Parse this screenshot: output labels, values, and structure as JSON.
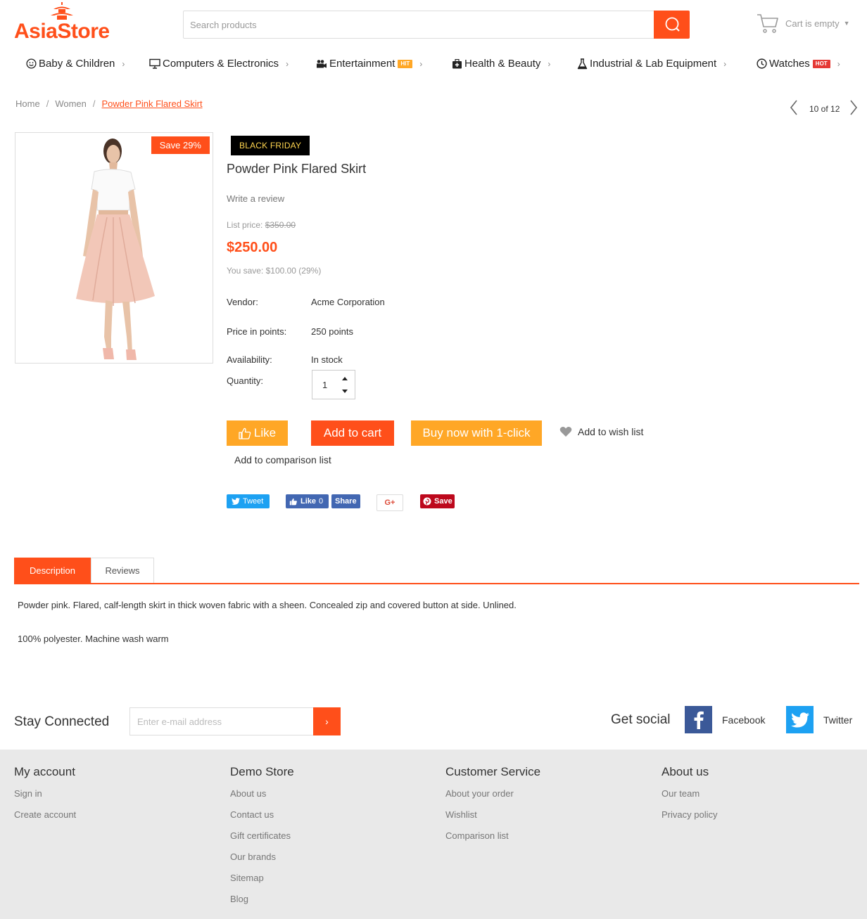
{
  "header": {
    "logo_part1": "Asia",
    "logo_part2": "Store",
    "search_placeholder": "Search products",
    "cart_label": "Cart is empty"
  },
  "menu": {
    "items": [
      {
        "label": "Baby & Children",
        "icon": "smile-icon"
      },
      {
        "label": "Computers & Electronics",
        "icon": "monitor-icon"
      },
      {
        "label": "Entertainment",
        "icon": "camera-icon",
        "badge": "HIT"
      },
      {
        "label": "Health & Beauty",
        "icon": "medkit-icon"
      },
      {
        "label": "Industrial & Lab Equipment",
        "icon": "flask-icon"
      },
      {
        "label": "Watches",
        "icon": "clock-icon",
        "badge": "HOT"
      }
    ]
  },
  "breadcrumb": {
    "home": "Home",
    "women": "Women",
    "current": "Powder Pink Flared Skirt",
    "sep": "/"
  },
  "pager": {
    "text": "10 of 12"
  },
  "product": {
    "save_badge": "Save 29%",
    "promo_badge": "BLACK FRIDAY",
    "title": "Powder Pink Flared Skirt",
    "write_review": "Write a review",
    "list_price_label": "List price:",
    "list_price": "$350.00",
    "price": "$250.00",
    "you_save": "You save: $100.00 (29%)",
    "vendor_label": "Vendor:",
    "vendor": "Acme Corporation",
    "points_label": "Price in points:",
    "points": "250 points",
    "availability_label": "Availability:",
    "availability": "In stock",
    "quantity_label": "Quantity:",
    "quantity": "1"
  },
  "buttons": {
    "like": "Like",
    "add_to_cart": "Add to cart",
    "buy_now": "Buy now with 1-click",
    "wish": "Add to wish list",
    "compare": "Add to comparison list"
  },
  "share": {
    "tweet": "Tweet",
    "fb_like": "Like",
    "fb_like_count": "0",
    "fb_share": "Share",
    "gplus": "G+",
    "pin": "Save"
  },
  "tabs": {
    "description": "Description",
    "reviews": "Reviews"
  },
  "description": {
    "p1": "Powder pink. Flared, calf-length skirt in thick woven fabric with a sheen. Concealed zip and covered button at side. Unlined.",
    "p2": "100% polyester. Machine wash warm"
  },
  "newsletter": {
    "title": "Stay Connected",
    "placeholder": "Enter e-mail address",
    "social_title": "Get social",
    "facebook": "Facebook",
    "twitter": "Twitter"
  },
  "footer": {
    "col1": {
      "title": "My account",
      "links": [
        "Sign in",
        "Create account"
      ]
    },
    "col2": {
      "title": "Demo Store",
      "links": [
        "About us",
        "Contact us",
        "Gift certificates",
        "Our brands",
        "Sitemap",
        "Blog"
      ]
    },
    "col3": {
      "title": "Customer Service",
      "links": [
        "About your order",
        "Wishlist",
        "Comparison list"
      ]
    },
    "col4": {
      "title": "About us",
      "links": [
        "Our team",
        "Privacy policy"
      ]
    }
  },
  "colors": {
    "accent": "#ff4f1a",
    "orange_button": "#ffa726",
    "footer_bg": "#e9e9e9"
  }
}
